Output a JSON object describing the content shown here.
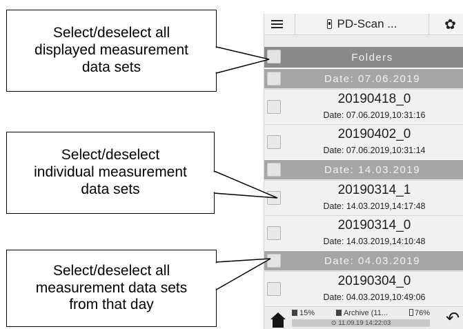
{
  "callouts": [
    {
      "text": "Select/deselect all\ndisplayed measurement\ndata sets"
    },
    {
      "text": "Select/deselect\nindividual measurement\ndata sets"
    },
    {
      "text": "Select/deselect all\nmeasurement data sets\nfrom that day"
    }
  ],
  "app": {
    "title": "PD-Scan ...",
    "icons": {
      "menu": "hamburger-icon",
      "device": "probe-icon",
      "settings": "gear-icon"
    }
  },
  "list": {
    "folders_label": "Folders",
    "groups": [
      {
        "date_label": "Date: 07.06.2019",
        "items": [
          {
            "name": "20190418_0",
            "timestamp": "Date: 07.06.2019,10:31:16"
          },
          {
            "name": "20190402_0",
            "timestamp": "Date: 07.06.2019,10:31:14"
          }
        ]
      },
      {
        "date_label": "Date: 14.03.2019",
        "items": [
          {
            "name": "20190314_1",
            "timestamp": "Date: 14.03.2019,14:17:48"
          },
          {
            "name": "20190314_0",
            "timestamp": "Date: 14.03.2019,14:10:48"
          }
        ]
      },
      {
        "date_label": "Date: 04.03.2019",
        "items": [
          {
            "name": "20190304_0",
            "timestamp": "Date: 04.03.2019,10:49:06"
          }
        ]
      }
    ]
  },
  "statusbar": {
    "memory": "15%",
    "archive": "Archive (11...",
    "battery": "76%",
    "timestamp": "⊙ 11.09.19 14:22:03",
    "icons": {
      "home": "home-icon",
      "back": "back-arrow-icon",
      "memory": "sd-card-icon",
      "archive": "save-icon",
      "battery": "battery-icon"
    }
  }
}
